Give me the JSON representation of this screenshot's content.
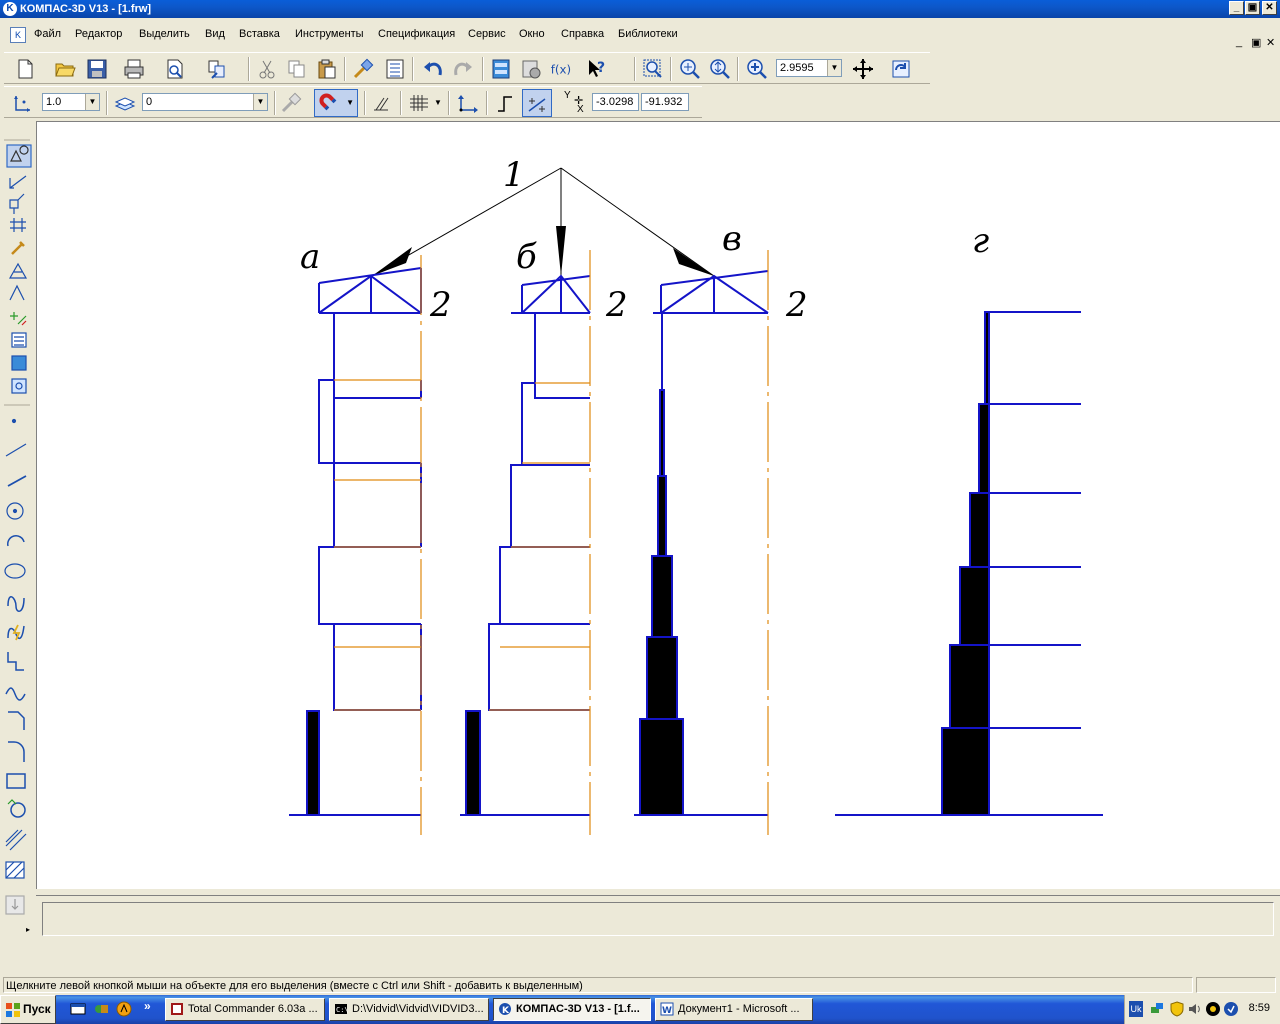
{
  "window": {
    "title": "КОМПАС-3D V13 - [1.frw]",
    "app_icon": "kompas-logo",
    "controls": [
      "_",
      "▣",
      "✕"
    ]
  },
  "menu": {
    "items": [
      "Файл",
      "Редактор",
      "Выделить",
      "Вид",
      "Вставка",
      "Инструменты",
      "Спецификация",
      "Сервис",
      "Окно",
      "Справка",
      "Библиотеки"
    ],
    "doc_controls": [
      "_",
      "▣",
      "✕"
    ]
  },
  "toolbar_standard": {
    "zoom_value": "2.9595",
    "icons": [
      "new-document-icon",
      "open-folder-icon",
      "save-icon",
      "print-icon",
      "print-preview-icon",
      "document-manager-icon",
      "cut-icon",
      "copy-icon",
      "paste-icon",
      "copy-properties-icon",
      "properties-list-icon",
      "undo-icon",
      "redo-icon",
      "manager-icon",
      "variables-icon",
      "function-icon",
      "help-cursor-icon",
      "zoom-window-icon",
      "zoom-in-icon",
      "zoom-fit-icon",
      "zoom-scale-icon",
      "pan-icon",
      "refresh-icon"
    ]
  },
  "toolbar_current_state": {
    "step_value": "1.0",
    "layer_value": "0",
    "coord_y_label": "Y",
    "coord_x_label": "X",
    "coord_x_value": "-3.0298",
    "coord_y_value": "-91.932"
  },
  "left_toolbar": {
    "icons": [
      "geometry-icon",
      "dimensions-icon",
      "designations-icon",
      "editing-icon",
      "parametrization-icon",
      "measure-icon",
      "select-icon",
      "spec-icon",
      "reports-icon",
      "insert-fragment-icon",
      "view-icon",
      "point-icon",
      "auxiliary-line-icon",
      "segment-icon",
      "circle-icon",
      "arc-icon",
      "ellipse-icon",
      "spline-icon",
      "continuous-input-icon",
      "polyline-icon",
      "nurbs-icon",
      "chamfer-icon",
      "fillet-icon",
      "rectangle-icon",
      "polygon-icon",
      "equidistant-icon",
      "hatch-icon",
      "collect-contour-icon"
    ]
  },
  "drawing": {
    "label_1": "1",
    "label_a": "а",
    "label_b": "б",
    "label_v": "в",
    "label_g": "г",
    "label_2_a": "2",
    "label_2_b": "2",
    "label_2_v": "2"
  },
  "status": {
    "message": "Щелкните левой кнопкой мыши на объекте для его выделения (вместе с Ctrl или Shift - добавить к выделенным)"
  },
  "taskbar": {
    "start_label": "Пуск",
    "quick_more": "»",
    "buttons": [
      {
        "label": "Total Commander 6.03a ...",
        "icon": "total-commander-icon"
      },
      {
        "label": "D:\\Vidvid\\Vidvid\\VIDVID3...",
        "icon": "console-icon"
      },
      {
        "label": "КОМПАС-3D V13 - [1.f...",
        "icon": "kompas-icon"
      },
      {
        "label": "Документ1 - Microsoft ...",
        "icon": "word-icon"
      }
    ],
    "tray": {
      "language": "Uk",
      "clock": "8:59"
    }
  }
}
